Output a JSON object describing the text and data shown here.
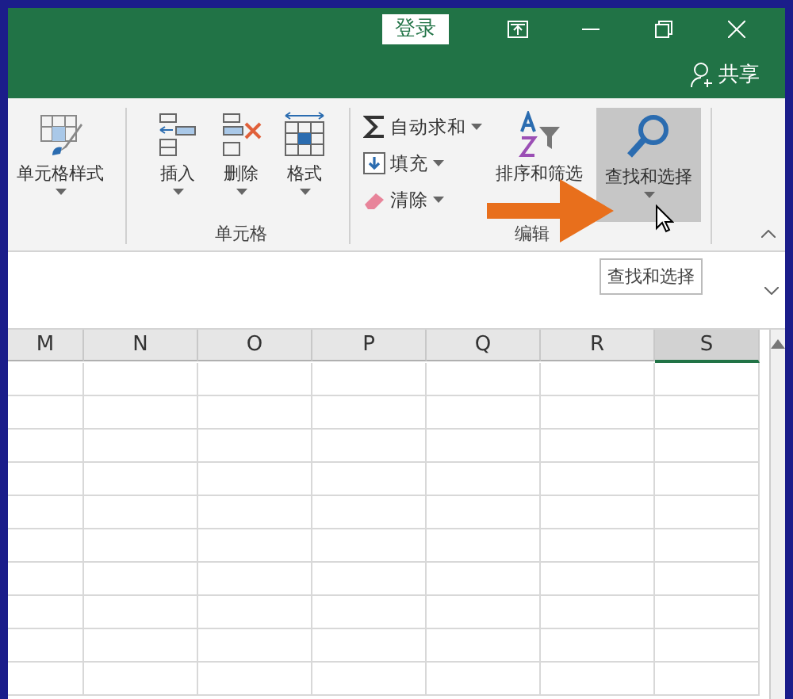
{
  "title_bar": {
    "sign_in": "登录",
    "share": "共享"
  },
  "ribbon": {
    "style_button": {
      "label": "单元格样式"
    },
    "cells_group": {
      "label": "单元格",
      "buttons": [
        {
          "kind": "insert",
          "label": "插入"
        },
        {
          "kind": "delete",
          "label": "删除"
        },
        {
          "kind": "format",
          "label": "格式"
        }
      ]
    },
    "editing_group": {
      "label": "编辑",
      "small_buttons": [
        {
          "kind": "sum",
          "label": "自动求和"
        },
        {
          "kind": "fill",
          "label": "填充"
        },
        {
          "kind": "clear",
          "label": "清除"
        }
      ],
      "sort_button": {
        "label": "排序和筛选"
      },
      "find_button": {
        "label": "查找和选择",
        "highlighted": true
      }
    }
  },
  "tooltip": "查找和选择",
  "sheet": {
    "columns": [
      {
        "label": "M",
        "selected": false
      },
      {
        "label": "N",
        "selected": false
      },
      {
        "label": "O",
        "selected": false
      },
      {
        "label": "P",
        "selected": false
      },
      {
        "label": "Q",
        "selected": false
      },
      {
        "label": "R",
        "selected": false
      },
      {
        "label": "S",
        "selected": true
      }
    ]
  }
}
